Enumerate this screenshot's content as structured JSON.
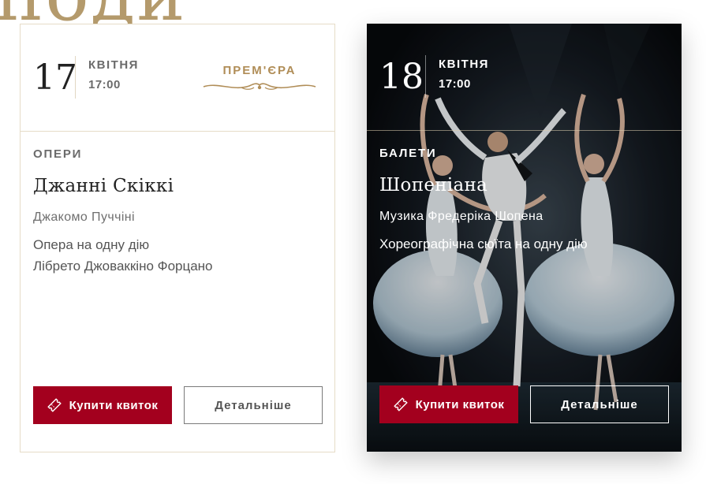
{
  "background_word": "поди",
  "colors": {
    "accent_red": "#a3001e",
    "gold": "#b08d57",
    "border": "#e6dcc7"
  },
  "cards": [
    {
      "day": "17",
      "month": "КВІТНЯ",
      "time": "17:00",
      "badge": "ПРЕМ'ЄРА",
      "genre": "ОПЕРИ",
      "title": "Джанні Скіккі",
      "composer": "Джакомо Пуччіні",
      "description_line1": "Опера на одну дію",
      "description_line2": "Лібрето Джоваккіно Форцано",
      "buy_label": "Купити квиток",
      "more_label": "Детальніше"
    },
    {
      "day": "18",
      "month": "КВІТНЯ",
      "time": "17:00",
      "genre": "БАЛЕТИ",
      "title": "Шопеніана",
      "composer": "Музика Фредеріка Шопена",
      "description_line1": "Хореографічна сюїта на одну дію",
      "buy_label": "Купити квиток",
      "more_label": "Детальніше"
    }
  ]
}
